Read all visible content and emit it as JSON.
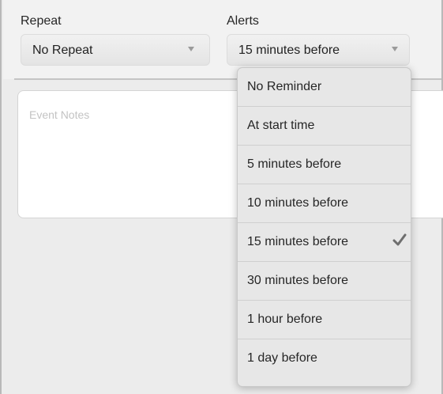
{
  "repeat": {
    "label": "Repeat",
    "value": "No Repeat",
    "icon": "chevron-down-icon"
  },
  "alerts": {
    "label": "Alerts",
    "value": "15 minutes before",
    "icon": "chevron-down-icon"
  },
  "notes": {
    "placeholder": "Event Notes"
  },
  "menu": {
    "items": [
      {
        "label": "No Reminder"
      },
      {
        "label": "At start time"
      },
      {
        "label": "5 minutes before"
      },
      {
        "label": "10 minutes before"
      },
      {
        "label": "15 minutes before",
        "selected": true,
        "check_icon": "checkmark-icon"
      },
      {
        "label": "30 minutes before"
      },
      {
        "label": "1 hour before"
      },
      {
        "label": "1 day before"
      }
    ]
  },
  "colors": {
    "checkmark": "#6e6e6e",
    "menu_bg": "#e7e7e7",
    "page_bg": "#ececec"
  }
}
